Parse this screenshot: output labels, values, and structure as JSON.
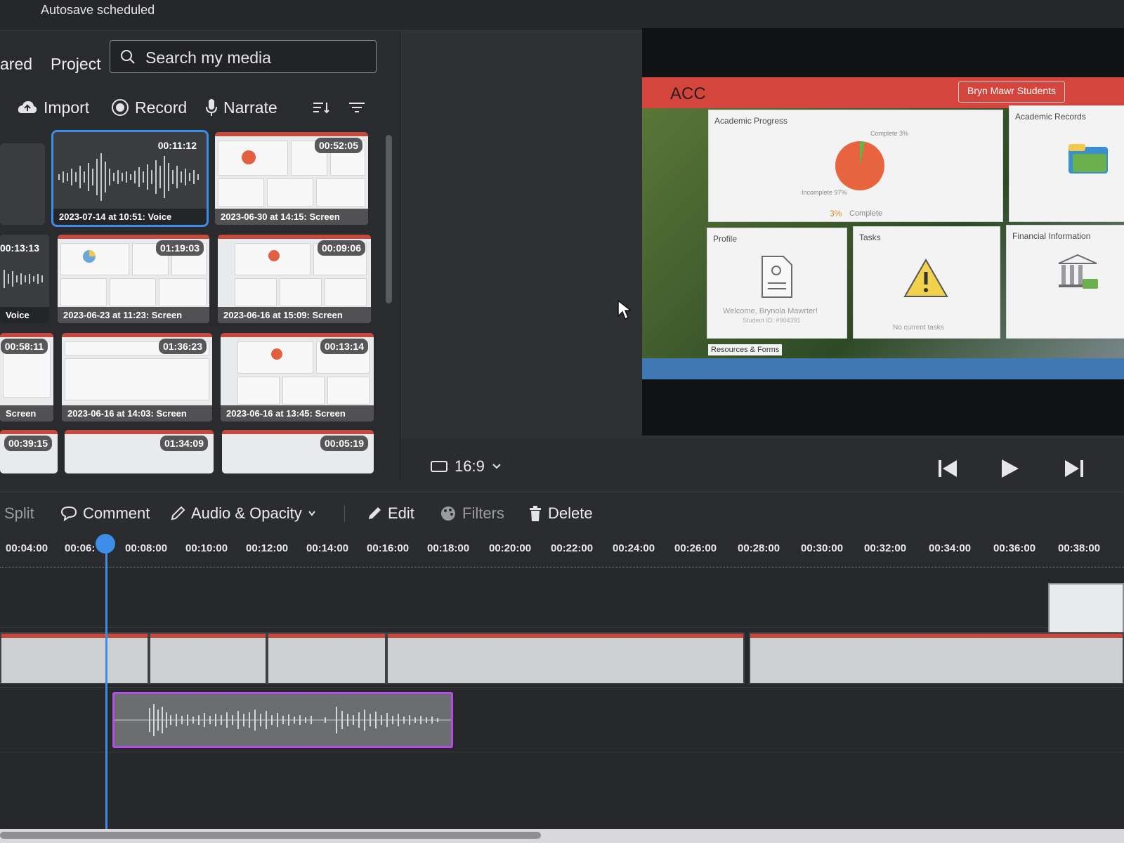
{
  "status": {
    "autosave": "Autosave scheduled"
  },
  "media": {
    "tabs": [
      "ared",
      "Project"
    ],
    "search_placeholder": "Search my media",
    "toolbar": {
      "import": "Import",
      "record": "Record",
      "narrate": "Narrate"
    },
    "items": [
      {
        "duration": "",
        "label": ""
      },
      {
        "duration": "00:11:12",
        "label": "2023-07-14 at 10:51: Voice",
        "kind": "voice",
        "selected": true
      },
      {
        "duration": "00:52:05",
        "label": "2023-06-30 at 14:15: Screen",
        "kind": "screen"
      },
      {
        "duration": "00:13:13",
        "label": "Voice",
        "kind": "voice"
      },
      {
        "duration": "01:19:03",
        "label": "2023-06-23 at 11:23: Screen",
        "kind": "screen"
      },
      {
        "duration": "00:09:06",
        "label": "2023-06-16 at 15:09: Screen",
        "kind": "screen"
      },
      {
        "duration": "00:58:11",
        "label": "Screen",
        "kind": "screen"
      },
      {
        "duration": "01:36:23",
        "label": "2023-06-16 at 14:03: Screen",
        "kind": "screen"
      },
      {
        "duration": "00:13:14",
        "label": "2023-06-16 at 13:45: Screen",
        "kind": "screen"
      },
      {
        "duration": "00:39:15",
        "label": "",
        "kind": "screen"
      },
      {
        "duration": "01:34:09",
        "label": "",
        "kind": "screen"
      },
      {
        "duration": "00:05:19",
        "label": "",
        "kind": "screen"
      }
    ]
  },
  "preview": {
    "app_title": "ACC",
    "audience": "Bryn Mawr Students",
    "cards": {
      "academic_progress": "Academic Progress",
      "complete_small": "Complete 3%",
      "incomplete_small": "Incomplete 97%",
      "complete_pct": "3%",
      "complete_word": "Complete",
      "academic_records": "Academic Records",
      "profile": "Profile",
      "welcome": "Welcome, Brynola Mawrter!",
      "student_id": "Student ID: #904391",
      "tasks": "Tasks",
      "no_tasks": "No current tasks",
      "financial": "Financial Information",
      "resources": "Resources & Forms"
    },
    "aspect_ratio": "16:9"
  },
  "edit_toolbar": {
    "split": "Split",
    "comment": "Comment",
    "audio_opacity": "Audio & Opacity",
    "edit": "Edit",
    "filters": "Filters",
    "delete": "Delete"
  },
  "timeline": {
    "ticks": [
      "00:04:00",
      "00:06:",
      "00:08:00",
      "00:10:00",
      "00:12:00",
      "00:14:00",
      "00:16:00",
      "00:18:00",
      "00:20:00",
      "00:22:00",
      "00:24:00",
      "00:26:00",
      "00:28:00",
      "00:30:00",
      "00:32:00",
      "00:34:00",
      "00:36:00",
      "00:38:00"
    ]
  },
  "colors": {
    "accent": "#3d8ee8",
    "audio_clip_border": "#b24fe6",
    "acc_red": "#d4463d"
  }
}
